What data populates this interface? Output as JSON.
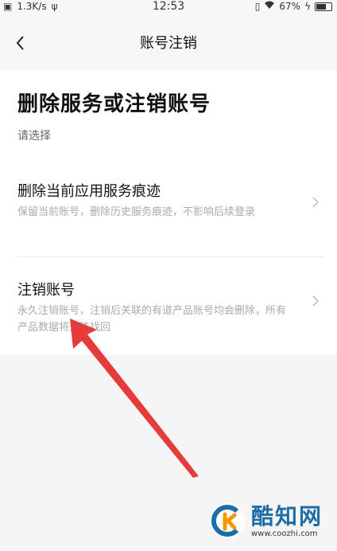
{
  "status_bar": {
    "speed": "1.3K/s",
    "time": "12:53",
    "battery": "67%",
    "battery_level": 0.67
  },
  "nav": {
    "title": "账号注销"
  },
  "main": {
    "heading": "删除服务或注销账号",
    "prompt": "请选择",
    "options": [
      {
        "title": "删除当前应用服务痕迹",
        "description": "保留当前账号，删除历史服务痕迹，不影响后续登录"
      },
      {
        "title": "注销账号",
        "description": "永久注销账号，注销后关联的有道产品账号均会删除，所有产品数据将无法找回"
      }
    ]
  },
  "watermark": {
    "name": "酷知网",
    "url": "www.coozhi.com"
  },
  "colors": {
    "arrow": "#e63b3b",
    "watermark_blue": "#1b6ea8",
    "watermark_orange": "#f39800"
  }
}
